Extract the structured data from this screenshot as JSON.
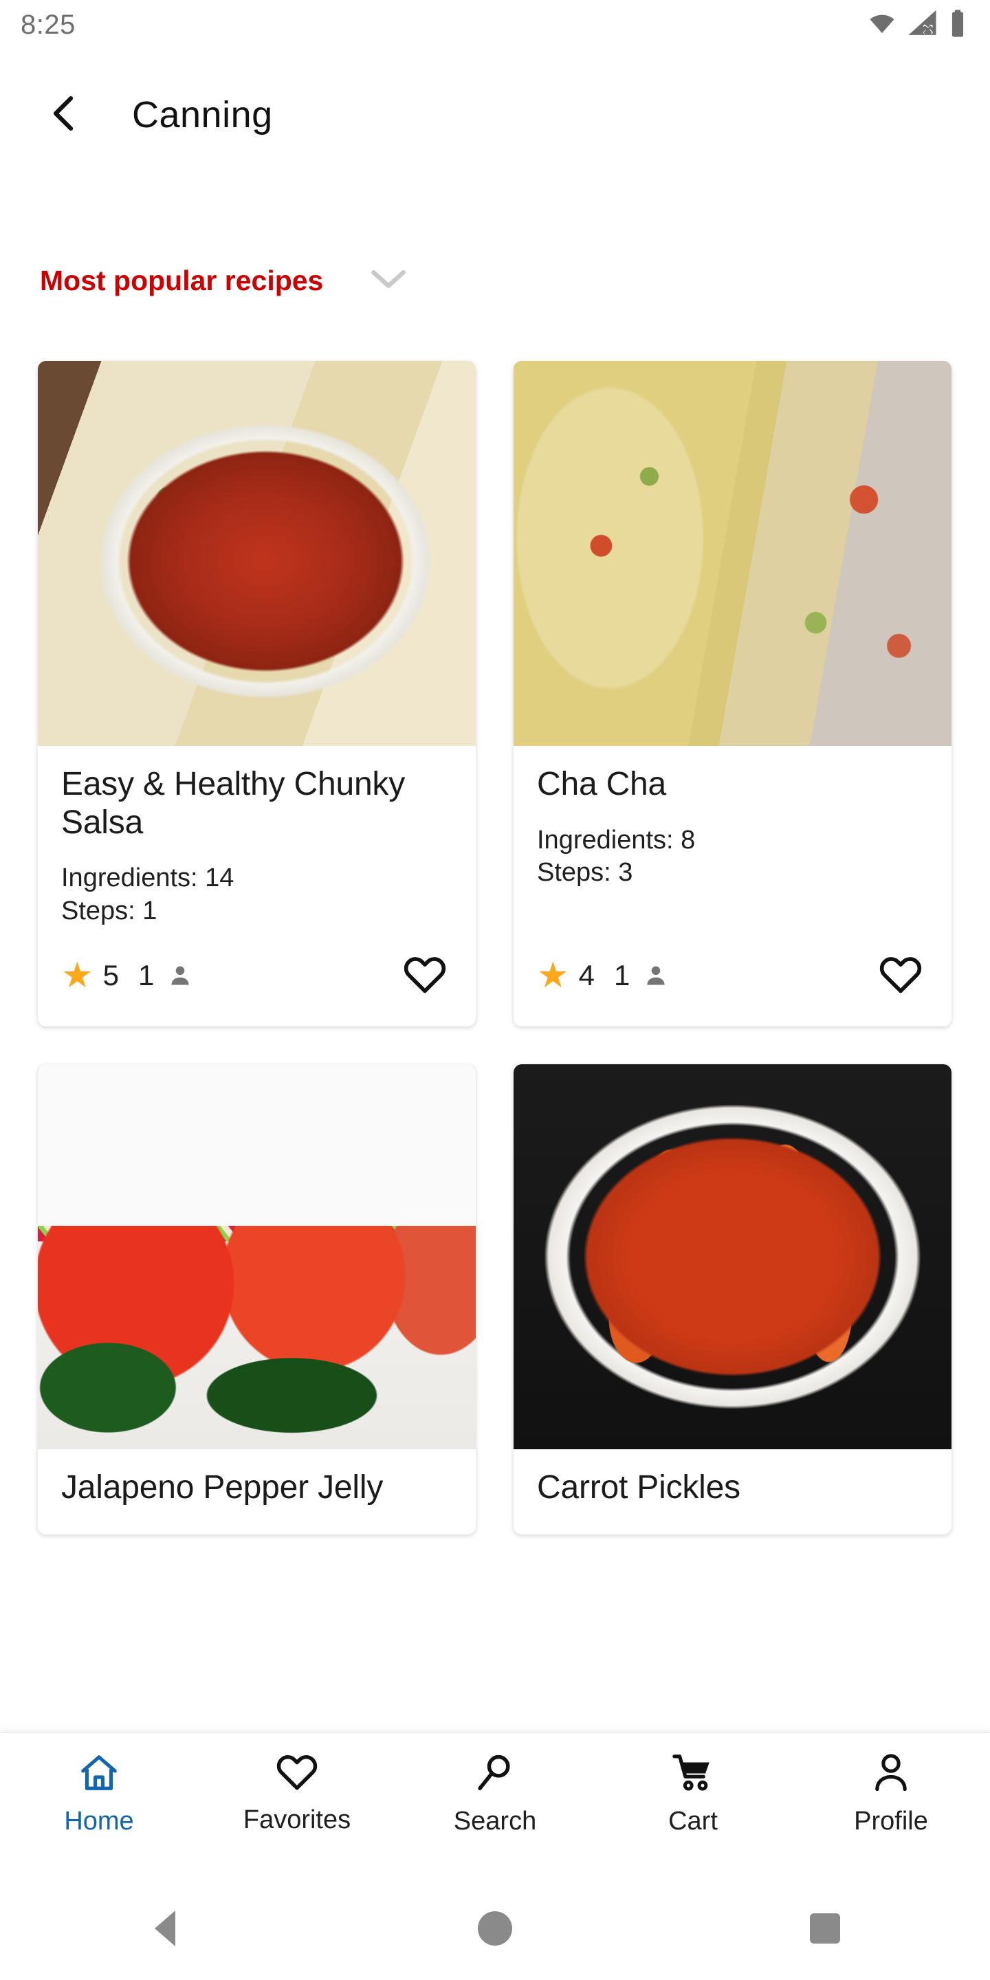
{
  "status_bar": {
    "time": "8:25",
    "icons": [
      "wifi-icon",
      "cellular-no-signal-icon",
      "battery-icon"
    ]
  },
  "app_bar": {
    "back_icon": "chevron-left-icon",
    "title": "Canning"
  },
  "filter": {
    "label": "Most popular recipes",
    "dropdown_icon": "chevron-down-icon",
    "label_color": "#cc0000"
  },
  "recipes": [
    {
      "title": "Easy & Healthy Chunky Salsa",
      "ingredients": "Ingredients: 14",
      "steps": "Steps: 1",
      "rating": "5",
      "reviews": "1",
      "image_alt": "chunky red salsa in white bowl with tortilla chips",
      "favorite_icon": "heart-outline-icon",
      "star_icon": "star-filled-icon",
      "person_icon": "person-icon"
    },
    {
      "title": "Cha Cha",
      "ingredients": "Ingredients: 8",
      "steps": "Steps: 3",
      "rating": "4",
      "reviews": "1",
      "image_alt": "cabbage relish in glass jar with red and green peppers",
      "favorite_icon": "heart-outline-icon",
      "star_icon": "star-filled-icon",
      "person_icon": "person-icon"
    },
    {
      "title": "Jalapeno Pepper Jelly",
      "image_alt": "jars of red pepper jelly with chili fabric covers and jalapenos"
    },
    {
      "title": "Carrot Pickles",
      "image_alt": "spicy red carrot pickles in white bowl"
    }
  ],
  "bottom_nav": {
    "active_color": "#1266ae",
    "items": [
      {
        "label": "Home",
        "icon": "home-icon",
        "active": true
      },
      {
        "label": "Favorites",
        "icon": "heart-outline-icon",
        "active": false
      },
      {
        "label": "Search",
        "icon": "search-icon",
        "active": false
      },
      {
        "label": "Cart",
        "icon": "shopping-cart-icon",
        "active": false
      },
      {
        "label": "Profile",
        "icon": "person-icon",
        "active": false
      }
    ]
  },
  "system_nav": {
    "back": "back-triangle-icon",
    "home": "home-circle-icon",
    "recents": "recents-square-icon"
  }
}
